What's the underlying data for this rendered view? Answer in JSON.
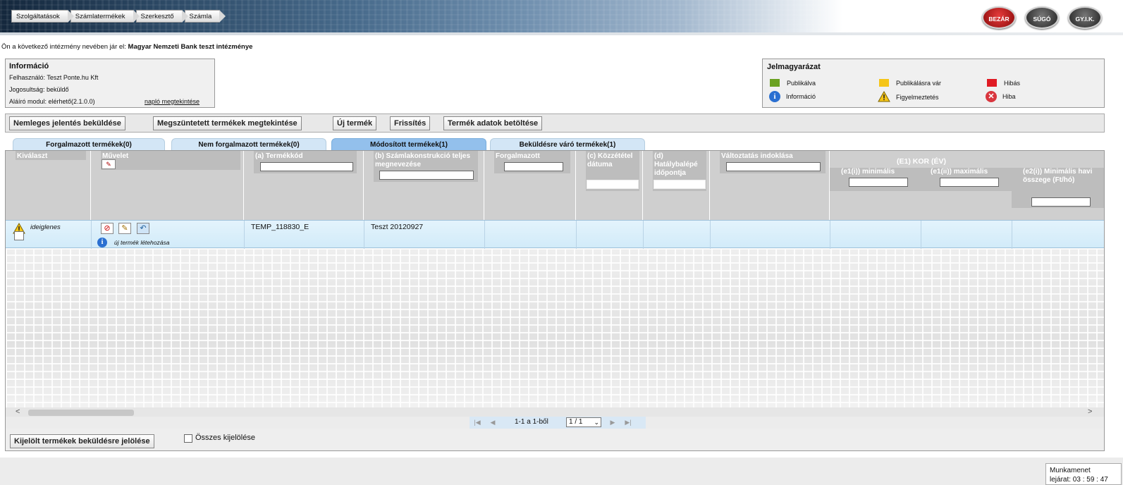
{
  "breadcrumb": [
    "Szolgáltatások",
    "Számlatermékek",
    "Szerkesztő",
    "Számla"
  ],
  "top_buttons": {
    "close": "BEZÁR",
    "help": "SÚGÓ",
    "faq": "GY.I.K."
  },
  "institution": {
    "prefix": "Ön a következő intézmény nevében jár el:",
    "name": "Magyar Nemzeti Bank teszt intézménye"
  },
  "info": {
    "title": "Információ",
    "user": "Felhasználó: Teszt Ponte.hu Kft",
    "role": "Jogosultság: beküldő",
    "signer": "Aláíró modul: elérhető(2.1.0.0)",
    "log_link": "napló megtekintése"
  },
  "legend": {
    "title": "Jelmagyarázat",
    "items": {
      "published": "Publikálva",
      "waiting": "Publikálásra vár",
      "faulty": "Hibás",
      "info": "Információ",
      "warning": "Figyelmeztetés",
      "error": "Hiba"
    },
    "colors": {
      "published": "#6aa121",
      "waiting": "#f5c518",
      "faulty": "#e01b24"
    }
  },
  "toolbar": {
    "null_report": "Nemleges jelentés beküldése",
    "view_terminated": "Megszüntetett termékek megtekintése",
    "new_product": "Új termék",
    "refresh": "Frissítés",
    "load_data": "Termék adatok betöltése"
  },
  "tabs": [
    "Forgalmazott termékek(0)",
    "Nem forgalmazott termékek(0)",
    "Módosított termékek(1)",
    "Beküldésre váró termékek(1)"
  ],
  "columns": {
    "select": "Kiválaszt",
    "operation": "Művelet",
    "code": "(a) Termékkód",
    "name": "(b) Számlakonstrukció teljes megnevezése",
    "distributed": "Forgalmazott",
    "publish_date": "(c) Közzététel dátuma",
    "effective_date": "(d) Hatálybalépé időpontja",
    "change_reason": "Változtatás indoklása",
    "age_group": "(E1) KOR (ÉV)",
    "age_min": "(e1(i)) minimális",
    "age_max": "(e1(ii)) maximális",
    "monthly_min": "(e2(i)) Minimális havi összege (Ft/hó)"
  },
  "row": {
    "status": "ideiglenes",
    "note": "új termék létehozása",
    "code": "TEMP_118830_E",
    "name": "Teszt 20120927"
  },
  "pager": {
    "summary": "1-1 a 1-ből",
    "page_select": "1 / 1"
  },
  "bottom": {
    "mark_button": "Kijelölt termékek beküldésre jelölése",
    "select_all": "Összes kijelölése"
  },
  "session": {
    "label": "Munkamenet",
    "expiry": "lejárat: 03 : 59 : 47"
  }
}
